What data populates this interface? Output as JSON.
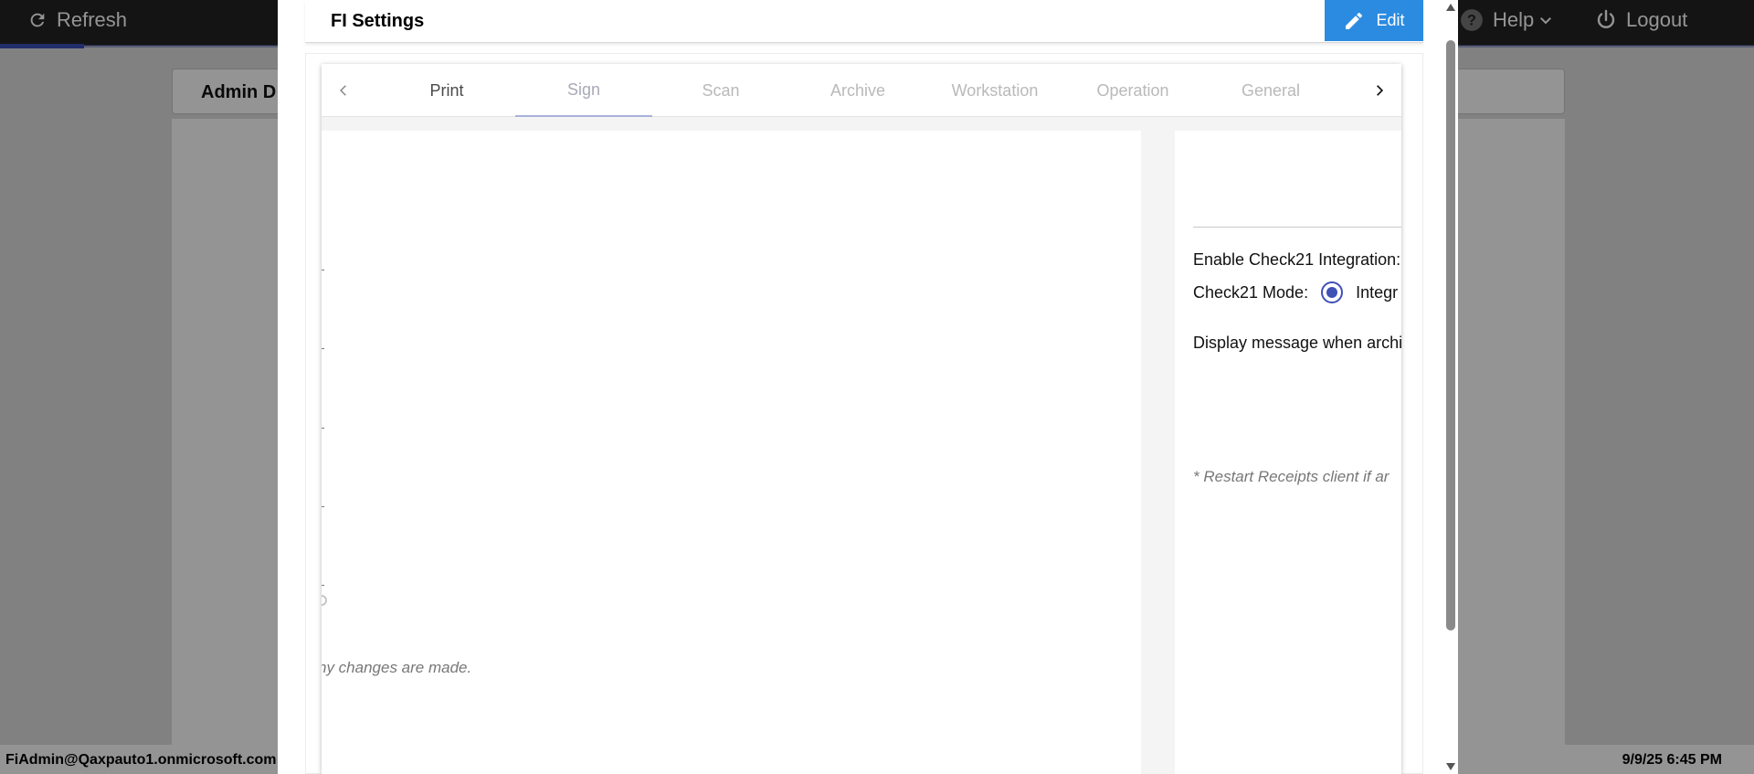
{
  "topbar": {
    "refresh_label": "Refresh",
    "help_label": "Help",
    "logout_label": "Logout"
  },
  "admin": {
    "title": "Admin D"
  },
  "footer": {
    "user": "FiAdmin@Qaxpauto1.onmicrosoft.com",
    "datetime": "9/9/25 6:45 PM"
  },
  "modal": {
    "title": "FI Settings",
    "edit_label": "Edit",
    "tabs": [
      {
        "label": "Print"
      },
      {
        "label": "Sign"
      },
      {
        "label": "Scan"
      },
      {
        "label": "Archive"
      },
      {
        "label": "Workstation"
      },
      {
        "label": "Operation"
      },
      {
        "label": "General"
      }
    ],
    "selected_tab": "Sign",
    "left_panel": {
      "note_fragment": "ny changes are made."
    },
    "right_panel": {
      "enable_check21_label": "Enable Check21 Integration:",
      "check21_mode_label": "Check21 Mode:",
      "check21_mode_value": "Integr",
      "display_message_label": "Display message when archi",
      "restart_note": "* Restart Receipts client if ar"
    }
  },
  "colors": {
    "accent": "#3f51b5",
    "edit_button": "#2b8be0",
    "topbar": "#232323"
  }
}
